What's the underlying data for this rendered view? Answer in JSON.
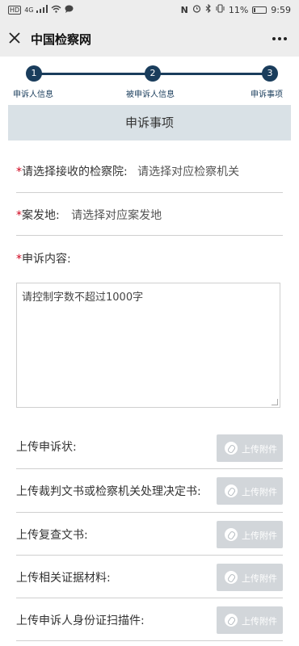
{
  "status_bar": {
    "left_icons": [
      "HD",
      "4G",
      "signal-icon",
      "wifi-icon",
      "chat-bubble-icon"
    ],
    "right_icons": [
      "nfc-icon",
      "alarm-icon",
      "bluetooth-icon",
      "vibrate-icon"
    ],
    "battery_percent": "11%",
    "battery_level": 0.11,
    "time": "9:59"
  },
  "navbar": {
    "close_icon": "close-icon",
    "title": "中国检察网",
    "more_icon": "more-icon"
  },
  "steps": [
    {
      "number": "1",
      "label": "申诉人信息"
    },
    {
      "number": "2",
      "label": "被申诉人信息"
    },
    {
      "number": "3",
      "label": "申诉事项"
    }
  ],
  "section_title": "申诉事项",
  "form": {
    "procuratorate": {
      "required_mark": "*",
      "label": "请选择接收的检察院:",
      "value": "请选择对应检察机关"
    },
    "location": {
      "required_mark": "*",
      "label": "案发地:",
      "value": "请选择对应案发地"
    },
    "content": {
      "required_mark": "*",
      "label": "申诉内容:",
      "placeholder": "请控制字数不超过1000字"
    }
  },
  "uploads": [
    {
      "label": "上传申诉状:",
      "button": "上传附件"
    },
    {
      "label": "上传裁判文书或检察机关处理决定书:",
      "button": "上传附件"
    },
    {
      "label": "上传复查文书:",
      "button": "上传附件"
    },
    {
      "label": "上传相关证据材料:",
      "button": "上传附件"
    },
    {
      "label": "上传申诉人身份证扫描件:",
      "button": "上传附件"
    }
  ],
  "colors": {
    "step_accent": "#1a3d5c",
    "required": "#d0021b",
    "section_bg": "#d9e1e6",
    "upload_button_bg": "#d2d6da"
  }
}
